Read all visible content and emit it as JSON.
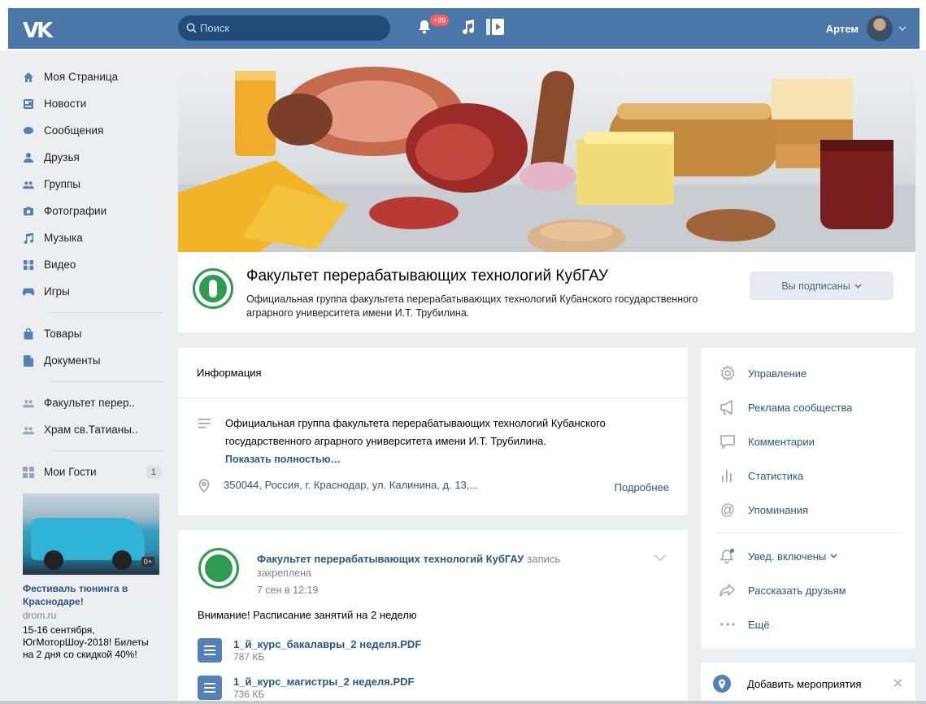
{
  "header": {
    "logo": "VK",
    "search_placeholder": "Поиск",
    "notifications_badge": "+99",
    "user_name": "Артем"
  },
  "sidebar": {
    "items": [
      {
        "label": "Моя Страница",
        "icon": "home-icon"
      },
      {
        "label": "Новости",
        "icon": "news-icon"
      },
      {
        "label": "Сообщения",
        "icon": "messages-icon"
      },
      {
        "label": "Друзья",
        "icon": "friend-icon"
      },
      {
        "label": "Группы",
        "icon": "groups-icon"
      },
      {
        "label": "Фотографии",
        "icon": "camera-icon"
      },
      {
        "label": "Музыка",
        "icon": "music-icon"
      },
      {
        "label": "Видео",
        "icon": "video-icon"
      },
      {
        "label": "Игры",
        "icon": "gamepad-icon"
      }
    ],
    "items2": [
      {
        "label": "Товары",
        "icon": "bag-icon"
      },
      {
        "label": "Документы",
        "icon": "document-icon"
      }
    ],
    "groups": [
      {
        "label": "Факультет перер.."
      },
      {
        "label": "Храм св.Татианы.."
      }
    ],
    "guests": {
      "label": "Мои Гости",
      "count": "1"
    },
    "ad": {
      "age": "0+",
      "title": "Фестиваль тюнинга в Краснодаре!",
      "source": "drom.ru",
      "text": "15-16 сентября, ЮгМоторШоу-2018! Билеты на 2 дня со скидкой 40%!"
    }
  },
  "group": {
    "title": "Факультет перерабатывающих технологий КубГАУ",
    "description": "Официальная группа факультета перерабатывающих технологий Кубанского государственного аграрного университета имени И.Т. Трубилина.",
    "subscribe_label": "Вы подписаны"
  },
  "info": {
    "heading": "Информация",
    "text": "Официальная группа факультета перерабатывающих технологий Кубанского государственного аграрного университета имени И.Т. Трубилина.",
    "show_more": "Показать полностью…",
    "address": "350044, Россия, г. Краснодар, ул. Калинина, д. 13,...",
    "details": "Подробнее"
  },
  "post": {
    "author": "Факультет перерабатывающих технологий КубГАУ",
    "note": "запись",
    "pinned": "закреплена",
    "date": "7 сен в 12:19",
    "text": "Внимание! Расписание занятий на 2 неделю",
    "files": [
      {
        "name": "1_й_курс_бакалавры_2 неделя.PDF",
        "size": "787 КБ"
      },
      {
        "name": "1_й_курс_магистры_2 неделя.PDF",
        "size": "736 КБ"
      }
    ]
  },
  "right_menu": {
    "items": [
      {
        "label": "Управление",
        "icon": "gear-icon"
      },
      {
        "label": "Реклама сообщества",
        "icon": "megaphone-icon"
      },
      {
        "label": "Комментарии",
        "icon": "comment-icon"
      },
      {
        "label": "Статистика",
        "icon": "stats-icon"
      },
      {
        "label": "Упоминания",
        "icon": "at-icon"
      }
    ],
    "items2": [
      {
        "label": "Увед. включены",
        "icon": "bell-icon"
      },
      {
        "label": "Рассказать друзьям",
        "icon": "share-icon"
      },
      {
        "label": "Ещё",
        "icon": "more-icon"
      }
    ]
  },
  "event": {
    "label": "Добавить мероприятия"
  },
  "colors": {
    "brand": "#4a76a8",
    "link": "#2a5885",
    "background": "#edeef0"
  }
}
